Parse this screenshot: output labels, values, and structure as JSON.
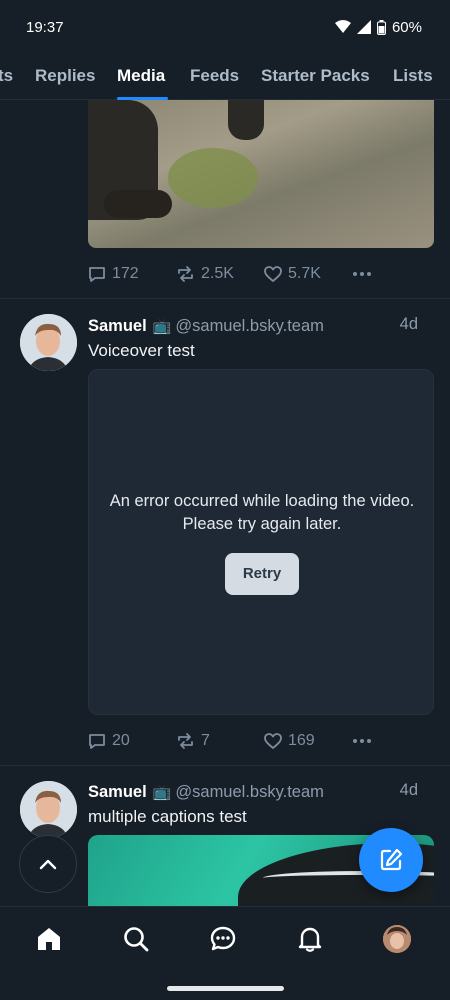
{
  "status_bar": {
    "time": "19:37",
    "battery": "60%"
  },
  "tabs": [
    {
      "label": "ts",
      "active": false
    },
    {
      "label": "Replies",
      "active": false
    },
    {
      "label": "Media",
      "active": true
    },
    {
      "label": "Feeds",
      "active": false
    },
    {
      "label": "Starter Packs",
      "active": false
    },
    {
      "label": "Lists",
      "active": false
    }
  ],
  "posts": [
    {
      "actions": {
        "replies": "172",
        "reposts": "2.5K",
        "likes": "5.7K"
      }
    },
    {
      "author": "Samuel",
      "author_emoji": "📺",
      "handle": "@samuel.bsky.team",
      "time": "4d",
      "text": "Voiceover test",
      "video_error": "An error occurred while loading the video. Please try again later.",
      "retry_label": "Retry",
      "actions": {
        "replies": "20",
        "reposts": "7",
        "likes": "169"
      }
    },
    {
      "author": "Samuel",
      "author_emoji": "📺",
      "handle": "@samuel.bsky.team",
      "time": "4d",
      "text": "multiple captions test"
    }
  ],
  "icons": {
    "reply": "speech-bubble-icon",
    "repost": "repost-arrows-icon",
    "like": "heart-icon",
    "more": "ellipsis-icon",
    "compose": "compose-pencil-icon",
    "scroll_top": "chevron-up-icon"
  },
  "nav": [
    "home-icon",
    "search-icon",
    "chat-icon",
    "bell-icon",
    "profile-avatar"
  ],
  "colors": {
    "background": "#161e27",
    "accent": "#208bfe",
    "muted": "#7b8d9f"
  }
}
